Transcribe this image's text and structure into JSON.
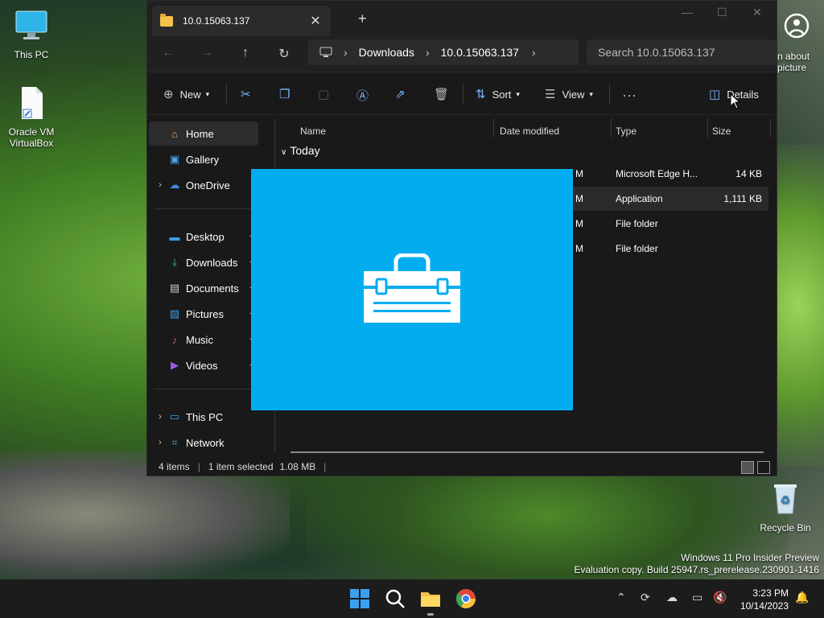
{
  "desktop": {
    "icons": [
      {
        "label": "This PC"
      },
      {
        "label": "Oracle VM\nVirtualBox"
      },
      {
        "label": "n about\npicture"
      },
      {
        "label": "Recycle Bin"
      }
    ]
  },
  "explorer": {
    "tab_title": "10.0.15063.137",
    "address": {
      "crumb1": "Downloads",
      "crumb2": "10.0.15063.137"
    },
    "search_placeholder": "Search 10.0.15063.137",
    "commands": {
      "new": "New",
      "sort": "Sort",
      "view": "View",
      "details": "Details"
    },
    "nav": [
      {
        "label": "Home"
      },
      {
        "label": "Gallery"
      },
      {
        "label": "OneDrive"
      },
      {
        "label": "Desktop"
      },
      {
        "label": "Downloads"
      },
      {
        "label": "Documents"
      },
      {
        "label": "Pictures"
      },
      {
        "label": "Music"
      },
      {
        "label": "Videos"
      },
      {
        "label": "This PC"
      },
      {
        "label": "Network"
      }
    ],
    "columns": {
      "name": "Name",
      "date": "Date modified",
      "type": "Type",
      "size": "Size"
    },
    "group": "Today",
    "rows": [
      {
        "m": "M",
        "type": "Microsoft Edge H...",
        "size": "14 KB"
      },
      {
        "m": "M",
        "type": "Application",
        "size": "1,111 KB"
      },
      {
        "m": "M",
        "type": "File folder",
        "size": ""
      },
      {
        "m": "M",
        "type": "File folder",
        "size": ""
      }
    ],
    "status": {
      "count": "4 items",
      "selected": "1 item selected",
      "size": "1.08 MB"
    }
  },
  "watermark": {
    "line1": "Windows 11 Pro Insider Preview",
    "line2": "Evaluation copy. Build 25947.rs_prerelease.230901-1416"
  },
  "clock": {
    "time": "3:23 PM",
    "date": "10/14/2023"
  },
  "colors": {
    "accent": "#01adef",
    "folder": "#f4c24a"
  }
}
